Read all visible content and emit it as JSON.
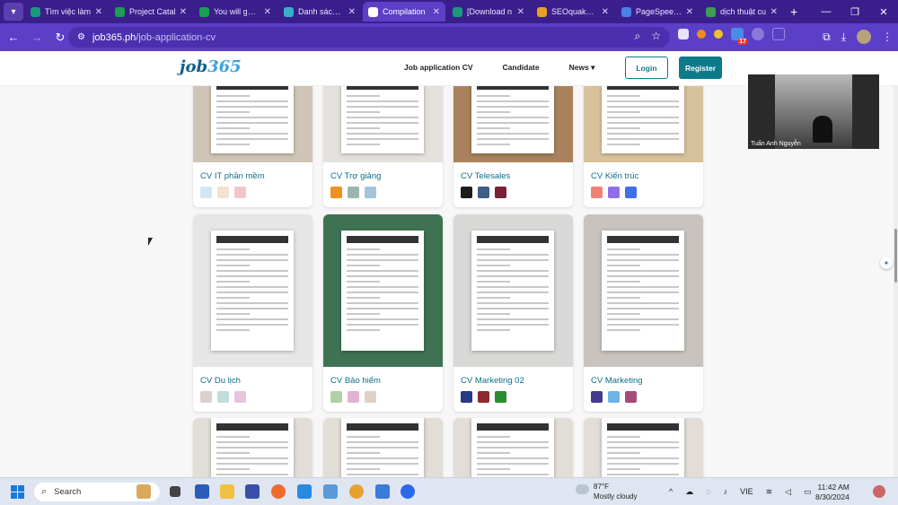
{
  "browser": {
    "tabs": [
      {
        "title": "Tìm việc làm",
        "color": "#1a9a7a",
        "active": false
      },
      {
        "title": "Project Catal",
        "color": "#1aa050",
        "active": false
      },
      {
        "title": "You will get a",
        "color": "#1aa050",
        "active": false
      },
      {
        "title": "Danh sách cu",
        "color": "#3ab0c8",
        "active": false
      },
      {
        "title": "Compilation",
        "color": "#ffffff",
        "active": true
      },
      {
        "title": "[Download n",
        "color": "#1a9a7a",
        "active": false
      },
      {
        "title": "SEOquake an",
        "color": "#e8a020",
        "active": false
      },
      {
        "title": "PageSpeed In",
        "color": "#4a80e8",
        "active": false
      },
      {
        "title": "dịch thuật cu",
        "color": "#3aa050",
        "active": false
      }
    ],
    "url_host": "job365.ph",
    "url_path": "/job-application-cv",
    "extension_badge": "17"
  },
  "site": {
    "logo_main": "job",
    "logo_num": "365",
    "nav": [
      "Job application CV",
      "Candidate",
      "News ▾"
    ],
    "login": "Login",
    "register": "Register"
  },
  "video_call": {
    "name": "Tuấn Anh Nguyễn"
  },
  "cards": [
    {
      "name": "CV IT phần mềm",
      "colors": [
        "#d2e6f5",
        "#f3e2d2",
        "#f2c6cc"
      ],
      "bg": "#cfc4b5"
    },
    {
      "name": "CV Trợ giảng",
      "colors": [
        "#f0901e",
        "#9bb5ae",
        "#a6c3dc"
      ],
      "bg": "#e4e1dc"
    },
    {
      "name": "CV Telesales",
      "colors": [
        "#1c1c1c",
        "#3d5f86",
        "#7a2036"
      ],
      "bg": "#a9825d"
    },
    {
      "name": "CV Kiến trúc",
      "colors": [
        "#ee8373",
        "#8f6fe8",
        "#3d6fe6"
      ],
      "bg": "#d8c29c"
    },
    {
      "name": "CV Du lịch",
      "colors": [
        "#dcd0ca",
        "#c3dcd8",
        "#e9c4de"
      ],
      "bg": "#e6e6e6"
    },
    {
      "name": "CV Bảo hiểm",
      "colors": [
        "#b2cfa8",
        "#e3b2d2",
        "#ddd1c8"
      ],
      "bg": "#3f7253"
    },
    {
      "name": "CV Marketing 02",
      "colors": [
        "#283a84",
        "#8d2a2e",
        "#2b8b30"
      ],
      "bg": "#d8d8d6"
    },
    {
      "name": "CV Marketing",
      "colors": [
        "#443b8e",
        "#6cb3e8",
        "#a84a78"
      ],
      "bg": "#c8c3be"
    }
  ],
  "taskbar": {
    "search": "Search",
    "temp": "87°F",
    "weather": "Mostly cloudy",
    "lang": "VIE",
    "time": "11:42 AM",
    "date": "8/30/2024"
  }
}
